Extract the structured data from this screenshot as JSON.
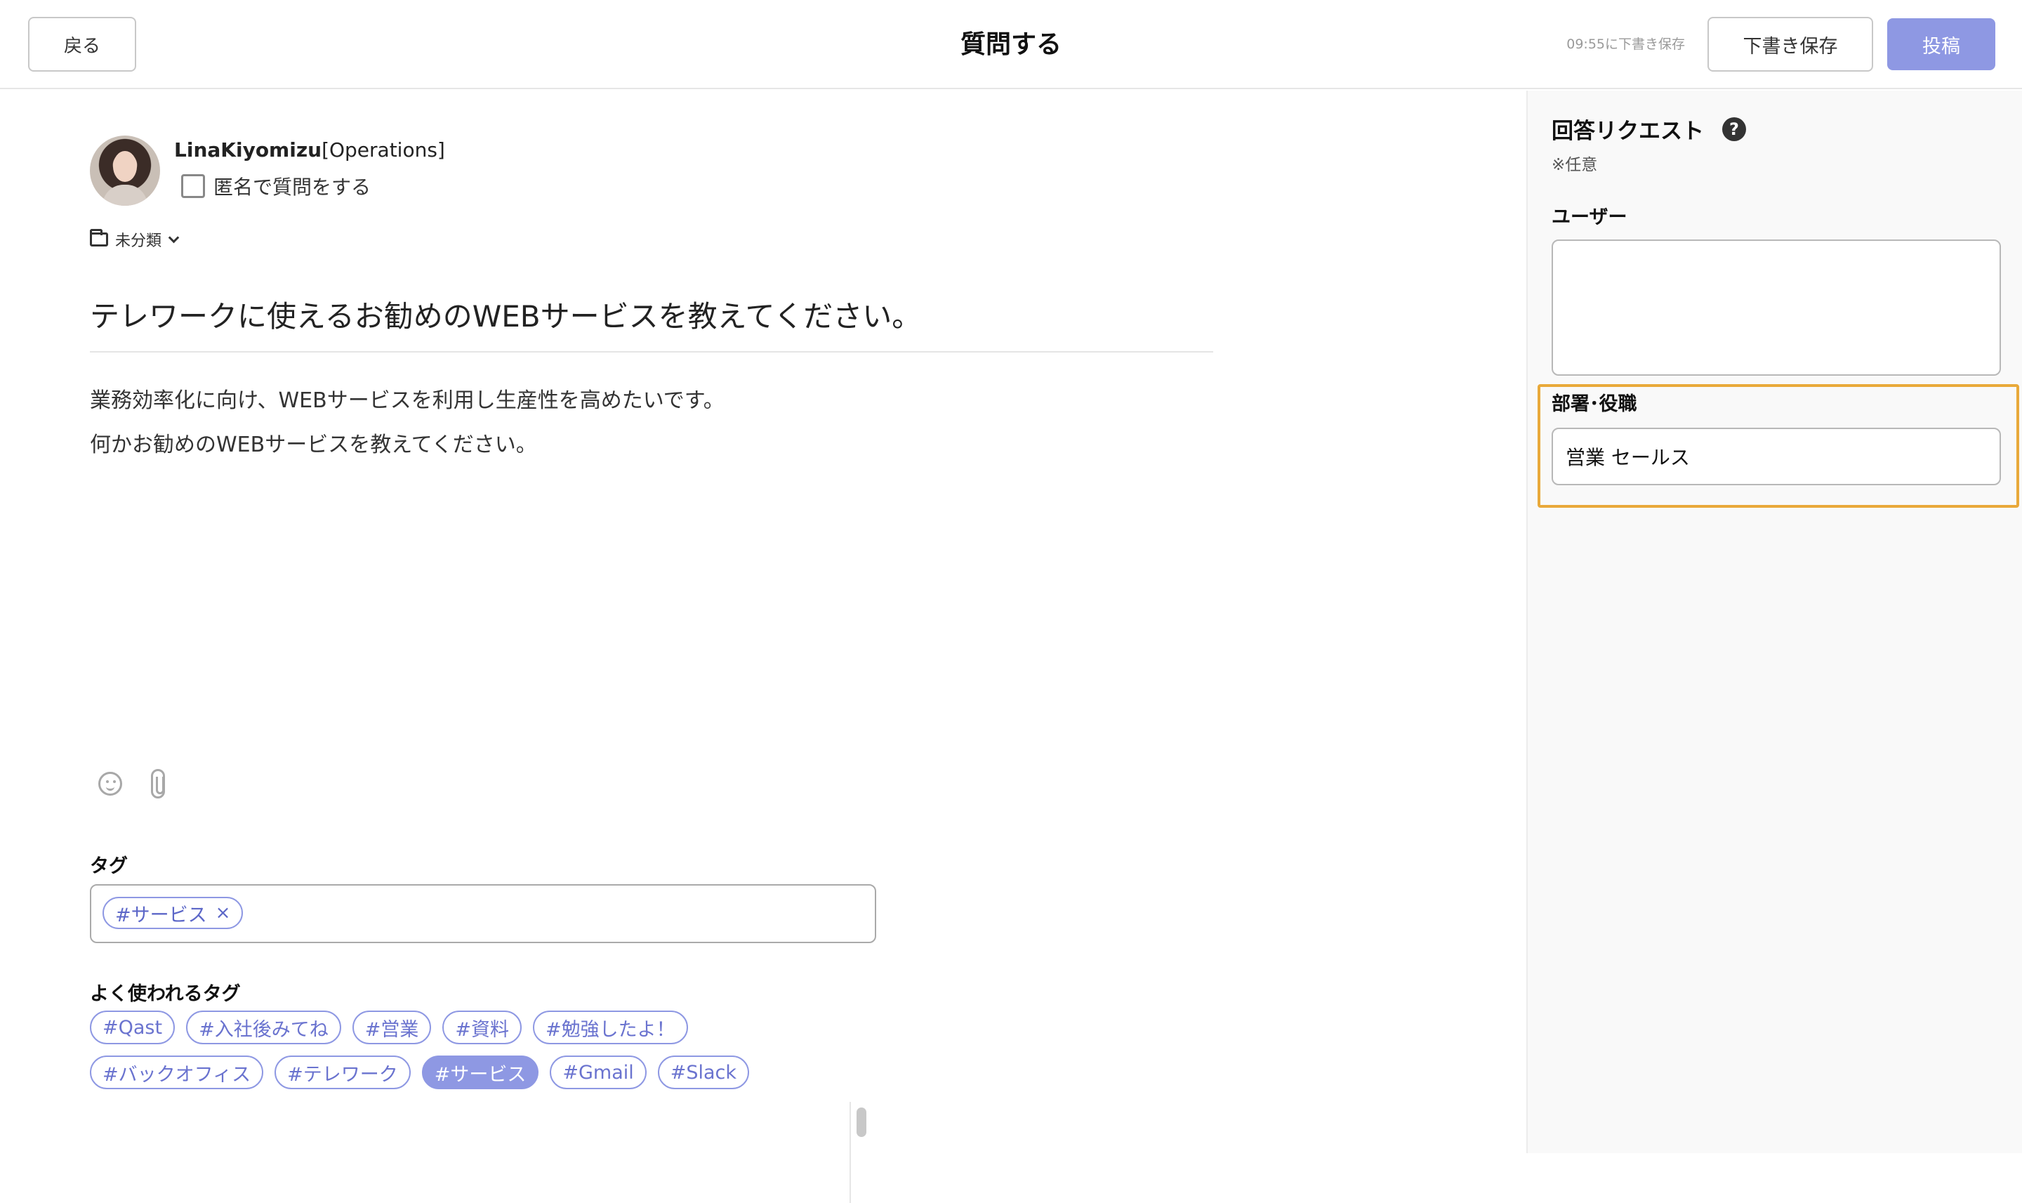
{
  "header": {
    "back_label": "戻る",
    "title": "質問する",
    "save_status": "09:55に下書き保存",
    "draft_label": "下書き保存",
    "post_label": "投稿"
  },
  "author": {
    "name": "LinaKiyomizu",
    "department": "[Operations]",
    "anonymous_label": "匿名で質問をする",
    "anonymous_checked": false
  },
  "category": {
    "label": "未分類"
  },
  "question": {
    "title": "テレワークに使えるお勧めのWEBサービスを教えてください。",
    "body_lines": [
      "業務効率化に向け、WEBサービスを利用し生産性を高めたいです。",
      "何かお勧めのWEBサービスを教えてください。"
    ]
  },
  "editor_icons": [
    "emoji-icon",
    "paperclip-icon"
  ],
  "tags": {
    "heading": "タグ",
    "selected": [
      {
        "label": "#サービス",
        "remove": "×"
      }
    ]
  },
  "frequent_tags": {
    "heading": "よく使われるタグ",
    "rows": [
      [
        "#Qast",
        "#入社後みてね",
        "#営業",
        "#資料",
        "#勉強したよ！"
      ],
      [
        "#バックオフィス",
        "#テレワーク",
        "#サービス",
        "#Gmail",
        "#Slack"
      ]
    ],
    "active": "#サービス"
  },
  "sidebar": {
    "title": "回答リクエスト",
    "help": "?",
    "note": "※任意",
    "user_label": "ユーザー",
    "user_value": "",
    "dept_label": "部署･役職",
    "dept_value": "営業 セールス"
  },
  "colors": {
    "accent": "#8e98e3",
    "highlight": "#e9a93a"
  }
}
